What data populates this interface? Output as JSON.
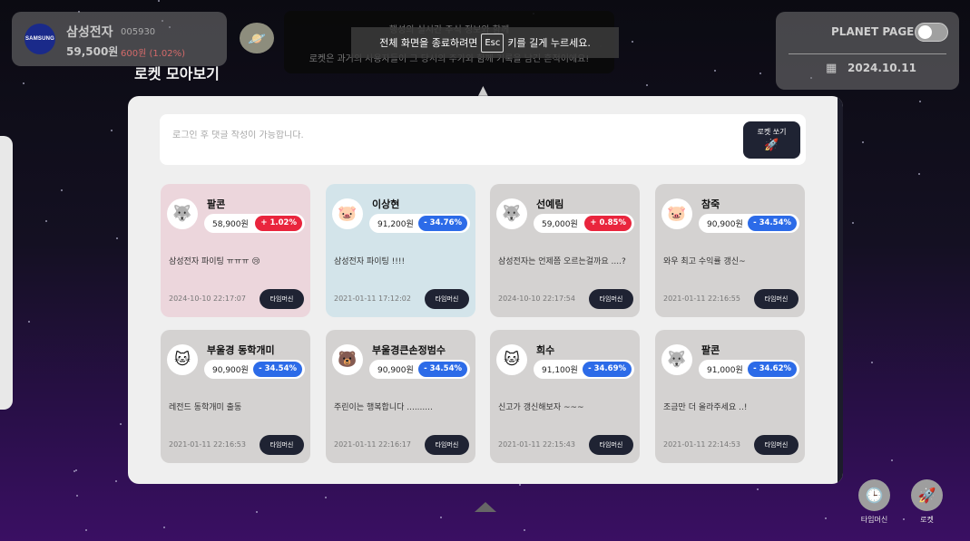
{
  "stock": {
    "logo_text": "SAMSUNG",
    "name": "삼성전자",
    "code": "005930",
    "price": "59,500원",
    "change": "600원 (1.02%)"
  },
  "notice": {
    "line1": "행성의 실시간 주식 정보와 함께",
    "line2": "로켓은 과거의 사용자들이 그 당시의 주가와 함께 기록을 남긴 흔적이에요!"
  },
  "esc_overlay": {
    "before": "전체 화면을 종료하려면",
    "key": "Esc",
    "after": "키를 길게 누르세요."
  },
  "page_title": "로켓 모아보기",
  "planet": {
    "label": "PLANET PAGE",
    "date": "2024.10.11",
    "calendar_icon": "calendar-icon"
  },
  "comment": {
    "placeholder": "로그인 후 댓글 작성이 가능합니다.",
    "button_label": "로켓 쏘기"
  },
  "colors": {
    "up": "#e9253d",
    "down": "#2c6be8",
    "card_pink": "#ecd6dc",
    "card_blue": "#d3e4ea",
    "card_gray": "#d4d2d1"
  },
  "cards": [
    {
      "name": "팔콘",
      "price": "58,900원",
      "change": "+ 1.02%",
      "dir": "up",
      "text": "삼성전자 파이팅 ㅠㅠㅠ 😢",
      "time": "2024-10-10 22:17:07",
      "button": "타임머신",
      "bg": "pink",
      "avatar": "🐺"
    },
    {
      "name": "이상현",
      "price": "91,200원",
      "change": "- 34.76%",
      "dir": "down",
      "text": "삼성전자 파이팅 !!!!",
      "time": "2021-01-11 17:12:02",
      "button": "타임머신",
      "bg": "blue",
      "avatar": "🐷"
    },
    {
      "name": "선예림",
      "price": "59,000원",
      "change": "+ 0.85%",
      "dir": "up",
      "text": "삼성전자는 언제쯤 오르는걸까요 ....?",
      "time": "2024-10-10 22:17:54",
      "button": "타임머신",
      "bg": "gray",
      "avatar": "🐺"
    },
    {
      "name": "참죽",
      "price": "90,900원",
      "change": "- 34.54%",
      "dir": "down",
      "text": "와우 최고 수익률 갱신~",
      "time": "2021-01-11 22:16:55",
      "button": "타임머신",
      "bg": "gray",
      "avatar": "🐷"
    },
    {
      "name": "부울경 동학개미",
      "price": "90,900원",
      "change": "- 34.54%",
      "dir": "down",
      "text": "레전드 동학개미 출동",
      "time": "2021-01-11 22:16:53",
      "button": "타임머신",
      "bg": "gray",
      "avatar": "🐱"
    },
    {
      "name": "부울경큰손정범수",
      "price": "90,900원",
      "change": "- 34.54%",
      "dir": "down",
      "text": "주린이는 행복합니다 ..........",
      "time": "2021-01-11 22:16:17",
      "button": "타임머신",
      "bg": "gray",
      "avatar": "🐻"
    },
    {
      "name": "희수",
      "price": "91,100원",
      "change": "- 34.69%",
      "dir": "down",
      "text": "신고가 갱신해보자 ~~~",
      "time": "2021-01-11 22:15:43",
      "button": "타임머신",
      "bg": "gray",
      "avatar": "🐱"
    },
    {
      "name": "팔콘",
      "price": "91,000원",
      "change": "- 34.62%",
      "dir": "down",
      "text": "조금만 더 올라주세요 ..!",
      "time": "2021-01-11 22:14:53",
      "button": "타임머신",
      "bg": "gray",
      "avatar": "🐺"
    }
  ],
  "side_buttons": {
    "timemachine": "타임머신",
    "rocket": "로켓"
  }
}
